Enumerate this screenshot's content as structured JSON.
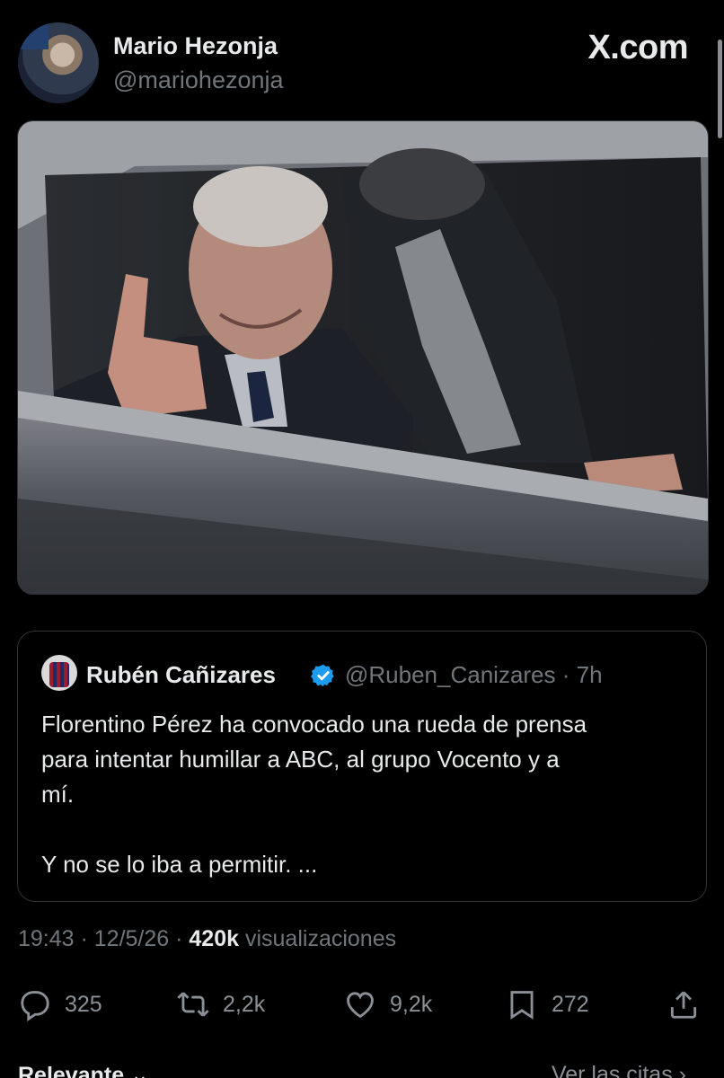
{
  "author": {
    "name": "Mario Hezonja",
    "handle": "@mariohezonja"
  },
  "brand": "X.com",
  "quoted_post": {
    "name": "Rubén Cañizares",
    "handle": "@Ruben_Canizares · 7h",
    "text_lines": [
      "Florentino Pérez ha convocado una rueda de prensa",
      "para intentar humillar a ABC, al grupo Vocento y a",
      "mí."
    ],
    "text_last": "Y no se lo iba a permitir. ...",
    "verified_color": "#1d9bf0"
  },
  "meta": {
    "time_date": "19:43 · 12/5/26 · ",
    "views": "420k",
    "views_label": " visualizaciones"
  },
  "actions": {
    "replies": "325",
    "reposts": "2,2k",
    "likes": "9,2k",
    "bookmarks": "272"
  },
  "bottom": {
    "left_label": "Relevante ⌄",
    "right_label": "Ver las citas ›"
  },
  "icons": {
    "reply": "reply-icon",
    "repost": "repost-icon",
    "like": "heart-icon",
    "bookmark": "bookmark-icon",
    "share": "share-icon",
    "verified": "verified-badge-icon"
  }
}
